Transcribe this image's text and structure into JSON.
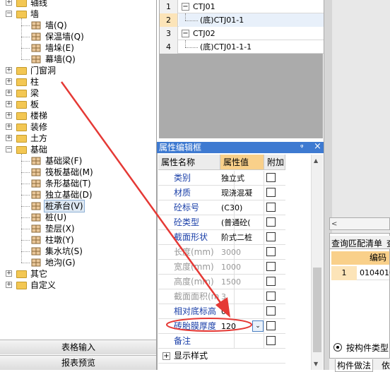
{
  "tree": {
    "items": [
      {
        "label": "轴线",
        "indent": 1,
        "kind": "folder",
        "expanded": false
      },
      {
        "label": "墙",
        "indent": 1,
        "kind": "folder",
        "expanded": true
      },
      {
        "label": "墙(Q)",
        "indent": 2,
        "kind": "item",
        "icon": "wall-icon"
      },
      {
        "label": "保温墙(Q)",
        "indent": 2,
        "kind": "item",
        "icon": "insulation-wall-icon"
      },
      {
        "label": "墙垛(E)",
        "indent": 2,
        "kind": "item",
        "icon": "wall-pier-icon"
      },
      {
        "label": "幕墙(Q)",
        "indent": 2,
        "kind": "item",
        "icon": "curtain-wall-icon"
      },
      {
        "label": "门窗洞",
        "indent": 1,
        "kind": "folder",
        "expanded": false
      },
      {
        "label": "柱",
        "indent": 1,
        "kind": "folder",
        "expanded": false
      },
      {
        "label": "梁",
        "indent": 1,
        "kind": "folder",
        "expanded": false
      },
      {
        "label": "板",
        "indent": 1,
        "kind": "folder",
        "expanded": false
      },
      {
        "label": "楼梯",
        "indent": 1,
        "kind": "folder",
        "expanded": false
      },
      {
        "label": "装修",
        "indent": 1,
        "kind": "folder",
        "expanded": false
      },
      {
        "label": "土方",
        "indent": 1,
        "kind": "folder",
        "expanded": false
      },
      {
        "label": "基础",
        "indent": 1,
        "kind": "folder",
        "expanded": true
      },
      {
        "label": "基础梁(F)",
        "indent": 2,
        "kind": "item",
        "icon": "foundation-beam-icon"
      },
      {
        "label": "筏板基础(M)",
        "indent": 2,
        "kind": "item",
        "icon": "raft-foundation-icon"
      },
      {
        "label": "条形基础(T)",
        "indent": 2,
        "kind": "item",
        "icon": "strip-foundation-icon"
      },
      {
        "label": "独立基础(D)",
        "indent": 2,
        "kind": "item",
        "icon": "isolated-foundation-icon"
      },
      {
        "label": "桩承台(V)",
        "indent": 2,
        "kind": "item",
        "icon": "pile-cap-icon",
        "selected": true
      },
      {
        "label": "桩(U)",
        "indent": 2,
        "kind": "item",
        "icon": "pile-icon"
      },
      {
        "label": "垫层(X)",
        "indent": 2,
        "kind": "item",
        "icon": "cushion-icon"
      },
      {
        "label": "柱墩(Y)",
        "indent": 2,
        "kind": "item",
        "icon": "column-pier-icon"
      },
      {
        "label": "集水坑(S)",
        "indent": 2,
        "kind": "item",
        "icon": "sump-pit-icon"
      },
      {
        "label": "地沟(G)",
        "indent": 2,
        "kind": "item",
        "icon": "trench-icon"
      },
      {
        "label": "其它",
        "indent": 1,
        "kind": "folder",
        "expanded": false
      },
      {
        "label": "自定义",
        "indent": 1,
        "kind": "folder",
        "expanded": false
      }
    ],
    "table_input_label": "表格输入",
    "report_preview_label": "报表预览"
  },
  "top_grid": {
    "rows": [
      {
        "num": "1",
        "text": "CTJ01",
        "tree": "minus"
      },
      {
        "num": "2",
        "text": "(底)CTJ01-1",
        "tree": "child",
        "active": true
      },
      {
        "num": "3",
        "text": "CTJ02",
        "tree": "minus"
      },
      {
        "num": "4",
        "text": "(底)CTJ01-1-1",
        "tree": "child"
      }
    ]
  },
  "property_panel": {
    "title": "属性编辑框",
    "pin": "ᵠ",
    "close": "×",
    "headers": {
      "name": "属性名称",
      "value": "属性值",
      "extra": "附加"
    },
    "rows": [
      {
        "name": "类别",
        "value": "独立式",
        "disabled": false
      },
      {
        "name": "材质",
        "value": "现浇混凝",
        "disabled": false
      },
      {
        "name": "砼标号",
        "value": "(C30)",
        "disabled": false
      },
      {
        "name": "砼类型",
        "value": "(普通砼(",
        "disabled": false
      },
      {
        "name": "截面形状",
        "value": "阶式二桩",
        "disabled": false
      },
      {
        "name": "长度(mm)",
        "value": "3000",
        "disabled": true
      },
      {
        "name": "宽度(mm)",
        "value": "1000",
        "disabled": true
      },
      {
        "name": "高度(mm)",
        "value": "1500",
        "disabled": true
      },
      {
        "name": "截面面积(m",
        "value": "3",
        "disabled": true
      },
      {
        "name": "相对底标高",
        "value": "0",
        "disabled": false
      },
      {
        "name": "砖胎膜厚度",
        "value": "120",
        "disabled": false,
        "dropdown": true
      },
      {
        "name": "备注",
        "value": "",
        "disabled": false
      }
    ],
    "show_style_label": "显示样式"
  },
  "right_panel": {
    "tab_query": "查询匹配清单",
    "tab_more": "查",
    "col_header": "编码",
    "row_num": "1",
    "row_code": "0104010",
    "radio_label": "按构件类型",
    "bottom_tab1": "构件做法",
    "bottom_tab2": "依"
  },
  "colors": {
    "accent": "#3e7ad1",
    "annotation": "#e53935",
    "value_header": "#f9d08a",
    "active_row": "#fce4b8"
  }
}
